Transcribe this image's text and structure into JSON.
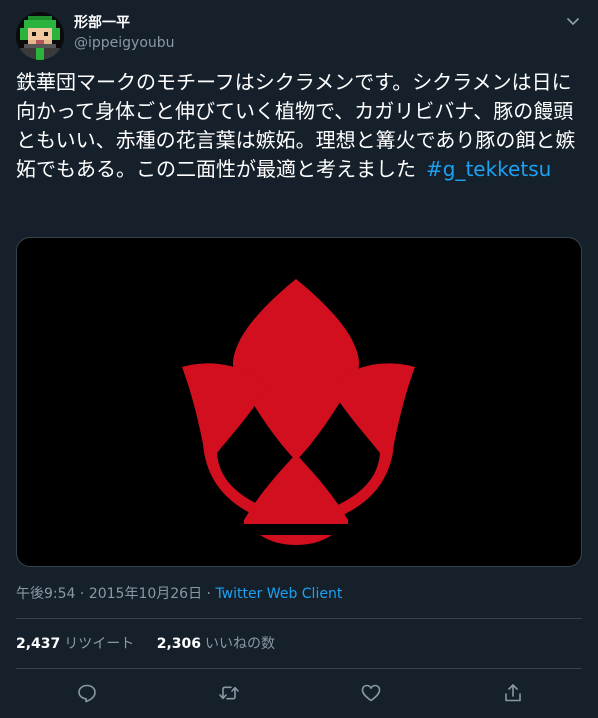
{
  "user": {
    "display_name": "形部一平",
    "handle": "@ippeigyoubu",
    "avatar_icon": "pixel-art-avatar-icon"
  },
  "tweet": {
    "text": "鉄華団マークのモチーフはシクラメンです。シクラメンは日に向かって身体ごと伸びていく植物で、カガリビバナ、豚の饅頭ともいい、赤種の花言葉は嫉妬。理想と篝火であり豚の餌と嫉妬でもある。この二面性が最適と考えました",
    "hashtag": "#g_tekketsu",
    "media_icon": "tekkadan-emblem-icon"
  },
  "meta": {
    "time": "午後9:54",
    "separator": " · ",
    "date": "2015年10月26日",
    "source": "Twitter Web Client"
  },
  "stats": {
    "retweets_count": "2,437",
    "retweets_label": "リツイート",
    "likes_count": "2,306",
    "likes_label": "いいねの数"
  },
  "actions": [
    "reply-icon",
    "retweet-icon",
    "like-icon",
    "share-icon"
  ],
  "colors": {
    "background": "#15202b",
    "accent": "#1da1f2",
    "secondary_text": "#8899a6",
    "border": "#38444d",
    "emblem_red": "#d20f1e"
  }
}
